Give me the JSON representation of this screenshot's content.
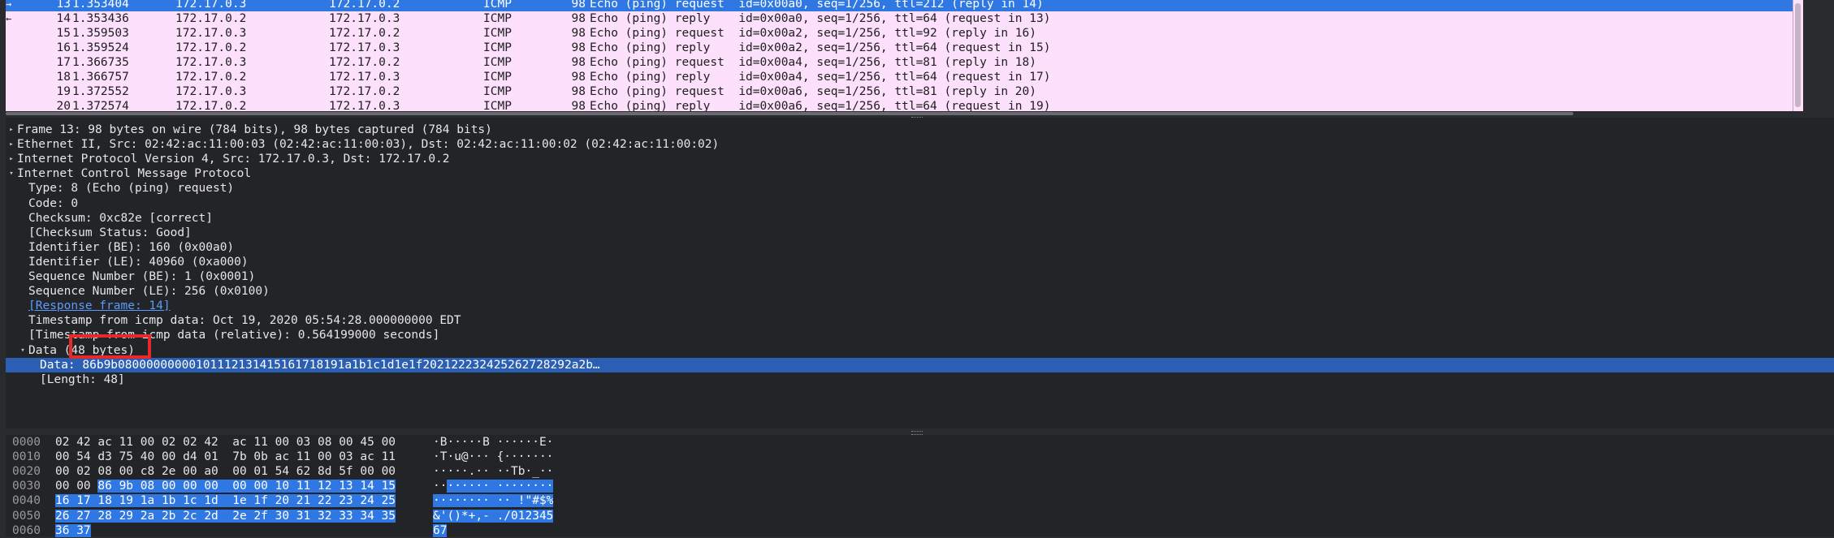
{
  "packet_list": {
    "rows": [
      {
        "no": "13",
        "time": "1.353404",
        "src": "172.17.0.3",
        "dst": "172.17.0.2",
        "proto": "ICMP",
        "len": "98",
        "info": "Echo (ping) request  id=0x00a0, seq=1/256, ttl=212 (reply in 14)",
        "selected": true,
        "rel": "→"
      },
      {
        "no": "14",
        "time": "1.353436",
        "src": "172.17.0.2",
        "dst": "172.17.0.3",
        "proto": "ICMP",
        "len": "98",
        "info": "Echo (ping) reply    id=0x00a0, seq=1/256, ttl=64 (request in 13)",
        "selected": false,
        "rel": "←"
      },
      {
        "no": "15",
        "time": "1.359503",
        "src": "172.17.0.3",
        "dst": "172.17.0.2",
        "proto": "ICMP",
        "len": "98",
        "info": "Echo (ping) request  id=0x00a2, seq=1/256, ttl=92 (reply in 16)",
        "selected": false,
        "rel": ""
      },
      {
        "no": "16",
        "time": "1.359524",
        "src": "172.17.0.2",
        "dst": "172.17.0.3",
        "proto": "ICMP",
        "len": "98",
        "info": "Echo (ping) reply    id=0x00a2, seq=1/256, ttl=64 (request in 15)",
        "selected": false,
        "rel": ""
      },
      {
        "no": "17",
        "time": "1.366735",
        "src": "172.17.0.3",
        "dst": "172.17.0.2",
        "proto": "ICMP",
        "len": "98",
        "info": "Echo (ping) request  id=0x00a4, seq=1/256, ttl=81 (reply in 18)",
        "selected": false,
        "rel": ""
      },
      {
        "no": "18",
        "time": "1.366757",
        "src": "172.17.0.2",
        "dst": "172.17.0.3",
        "proto": "ICMP",
        "len": "98",
        "info": "Echo (ping) reply    id=0x00a4, seq=1/256, ttl=64 (request in 17)",
        "selected": false,
        "rel": ""
      },
      {
        "no": "19",
        "time": "1.372552",
        "src": "172.17.0.3",
        "dst": "172.17.0.2",
        "proto": "ICMP",
        "len": "98",
        "info": "Echo (ping) request  id=0x00a6, seq=1/256, ttl=81 (reply in 20)",
        "selected": false,
        "rel": ""
      },
      {
        "no": "20",
        "time": "1.372574",
        "src": "172.17.0.2",
        "dst": "172.17.0.3",
        "proto": "ICMP",
        "len": "98",
        "info": "Echo (ping) reply    id=0x00a6, seq=1/256, ttl=64 (request in 19)",
        "selected": false,
        "rel": ""
      }
    ]
  },
  "details": {
    "rows": [
      {
        "indent": 0,
        "twisty": "▸",
        "text": "Frame 13: 98 bytes on wire (784 bits), 98 bytes captured (784 bits)",
        "selected": false,
        "link": false
      },
      {
        "indent": 0,
        "twisty": "▸",
        "text": "Ethernet II, Src: 02:42:ac:11:00:03 (02:42:ac:11:00:03), Dst: 02:42:ac:11:00:02 (02:42:ac:11:00:02)",
        "selected": false,
        "link": false
      },
      {
        "indent": 0,
        "twisty": "▸",
        "text": "Internet Protocol Version 4, Src: 172.17.0.3, Dst: 172.17.0.2",
        "selected": false,
        "link": false
      },
      {
        "indent": 0,
        "twisty": "▾",
        "text": "Internet Control Message Protocol",
        "selected": false,
        "link": false
      },
      {
        "indent": 1,
        "twisty": "",
        "text": "Type: 8 (Echo (ping) request)",
        "selected": false,
        "link": false
      },
      {
        "indent": 1,
        "twisty": "",
        "text": "Code: 0",
        "selected": false,
        "link": false
      },
      {
        "indent": 1,
        "twisty": "",
        "text": "Checksum: 0xc82e [correct]",
        "selected": false,
        "link": false
      },
      {
        "indent": 1,
        "twisty": "",
        "text": "[Checksum Status: Good]",
        "selected": false,
        "link": false
      },
      {
        "indent": 1,
        "twisty": "",
        "text": "Identifier (BE): 160 (0x00a0)",
        "selected": false,
        "link": false
      },
      {
        "indent": 1,
        "twisty": "",
        "text": "Identifier (LE): 40960 (0xa000)",
        "selected": false,
        "link": false
      },
      {
        "indent": 1,
        "twisty": "",
        "text": "Sequence Number (BE): 1 (0x0001)",
        "selected": false,
        "link": false
      },
      {
        "indent": 1,
        "twisty": "",
        "text": "Sequence Number (LE): 256 (0x0100)",
        "selected": false,
        "link": false
      },
      {
        "indent": 1,
        "twisty": "",
        "text": "[Response frame: 14]",
        "selected": false,
        "link": true
      },
      {
        "indent": 1,
        "twisty": "",
        "text": "Timestamp from icmp data: Oct 19, 2020 05:54:28.000000000 EDT",
        "selected": false,
        "link": false
      },
      {
        "indent": 1,
        "twisty": "",
        "text": "[Timestamp from icmp data (relative): 0.564199000 seconds]",
        "selected": false,
        "link": false
      },
      {
        "indent": 1,
        "twisty": "▾",
        "text": "Data (48 bytes)",
        "selected": false,
        "link": false
      },
      {
        "indent": 2,
        "twisty": "",
        "text": "Data: 86b9b08000000000101112131415161718191a1b1c1d1e1f202122232425262728292a2b…",
        "selected": true,
        "link": false
      },
      {
        "indent": 2,
        "twisty": "",
        "text": "[Length: 48]",
        "selected": false,
        "link": false
      }
    ]
  },
  "hex": {
    "rows": [
      {
        "offset": "0000",
        "pre": "02 42 ac 11 00 02 02 42  ac 11 00 03 08 00 45 00",
        "hl": "",
        "ascii_pre": "·B·····B ······E·",
        "ascii_hl": ""
      },
      {
        "offset": "0010",
        "pre": "00 54 d3 75 40 00 d4 01  7b 0b ac 11 00 03 ac 11",
        "hl": "",
        "ascii_pre": "·T·u@··· {·······",
        "ascii_hl": ""
      },
      {
        "offset": "0020",
        "pre": "00 02 08 00 c8 2e 00 a0  00 01 54 62 8d 5f 00 00",
        "hl": "",
        "ascii_pre": "·····.·· ··Tb·_··",
        "ascii_hl": ""
      },
      {
        "offset": "0030",
        "pre": "00 00 ",
        "hl": "86 9b 08 00 00 00  00 00 10 11 12 13 14 15",
        "ascii_pre": "··",
        "ascii_hl": "······ ········"
      },
      {
        "offset": "0040",
        "pre": "",
        "hl": "16 17 18 19 1a 1b 1c 1d  1e 1f 20 21 22 23 24 25",
        "ascii_pre": "",
        "ascii_hl": "········ ·· !\"#$%"
      },
      {
        "offset": "0050",
        "pre": "",
        "hl": "26 27 28 29 2a 2b 2c 2d  2e 2f 30 31 32 33 34 35",
        "ascii_pre": "",
        "ascii_hl": "&'()*+,- ./012345"
      },
      {
        "offset": "0060",
        "pre": "",
        "hl": "36 37",
        "ascii_pre": "",
        "ascii_hl": "67"
      }
    ]
  },
  "colors": {
    "list_bg": "#fde0fb",
    "selection": "#2f78e4",
    "annotation_box": "#e8292b"
  }
}
